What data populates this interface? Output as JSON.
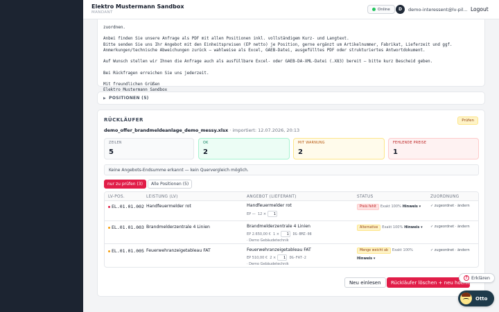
{
  "header": {
    "brand": "Elektro Mustermann Sandbox",
    "brand_sub": "MANDANT",
    "status": "Online",
    "avatar": "D",
    "user": "demo-interessent@lv-pil...",
    "logout": "Logout"
  },
  "mail": {
    "lines": [
      "zuordnen.",
      "",
      "Anbei finden Sie unsere Anfrage als PDF mit allen Positionen inkl. vollständigem Kurz- und Langtext.",
      "Bitte senden Sie uns Ihr Angebot mit den Einheitspreisen (EP netto) je Position, gerne ergänzt um Artikelnummer, Fabrikat, Lieferzeit und ggf.",
      "Anmerkungen/technische Abweichungen zurück — wahlweise als Excel, GAEB-Datei, ausgefülltes PDF oder strukturiertes Antwortdokument.",
      "",
      "Auf Wunsch stellen wir Ihnen die Anfrage auch als ausfüllbare Excel- oder GAEB-DA-XML-Datei (.X83) bereit — bitte kurz Bescheid geben.",
      "",
      "Bei Rückfragen erreichen Sie uns jederzeit.",
      "",
      "Mit freundlichen Grüßen",
      "Elektro Mustermann Sandbox"
    ]
  },
  "positionen": {
    "label": "POSITIONEN (5)"
  },
  "rueck": {
    "title": "RÜCKLÄUFER",
    "badge": "Prüfen",
    "file": "demo_offer_brandmeldeanlage_demo_messy.xlsx",
    "imported": " · importiert: 12.07.2026, 20:13",
    "stats": [
      {
        "label": "ZEILEN",
        "value": "5"
      },
      {
        "label": "OK",
        "value": "2"
      },
      {
        "label": "MIT WARNUNG",
        "value": "2"
      },
      {
        "label": "FEHLENDE PREISE",
        "value": "1"
      }
    ],
    "notice": "Keine Angebots-Endsumme erkannt — kein Quervergleich möglich.",
    "tabs": [
      "nur zu prüfen (3)",
      "Alle Positionen (5)"
    ],
    "columns": [
      "LV-POS.",
      "LEISTUNG (LV)",
      "ANGEBOT (LIEFERANT)",
      "STATUS",
      "ZUORDNUNG"
    ],
    "rows": [
      {
        "pos": "EL.01.01.002",
        "lv": "Handfeuermelder rot",
        "angebot": "Handfeuermelder rot",
        "ep": "EP —",
        "qty_prefix": "12 ×",
        "qty": "1",
        "art": "",
        "fabrikat": "",
        "badge": "Preis fehlt",
        "exakt": "Exakt 100%",
        "hinweis": "Hinweis ▾",
        "zuord": "✓ zugeordnet · ändern"
      },
      {
        "pos": "EL.01.01.003",
        "lv": "Brandmelderzentrale 4 Linien",
        "angebot": "Brandmelderzentrale 4 Linien",
        "ep": "EP 2.650,00 €",
        "qty_prefix": "1 ×",
        "qty": "1",
        "art": "DG-BMZ-08",
        "fabrikat": "· Demo Gebäudetechnik",
        "badge": "Alternative",
        "exakt": "Exakt 100%",
        "hinweis": "Hinweis ▾",
        "zuord": "✓ zugeordnet · ändern"
      },
      {
        "pos": "EL.01.01.005",
        "lv": "Feuerwehranzeigetableau FAT",
        "angebot": "Feuerwehranzeigetableau FAT",
        "ep": "EP 510,00 €",
        "qty_prefix": "2 ×",
        "qty": "1",
        "art": "DG-FAT-2",
        "fabrikat": "· Demo Gebäudetechnik",
        "badge": "Menge weicht ab",
        "exakt": "Exakt 100%",
        "hinweis": "Hinweis ▾",
        "zuord": "✓ zugeordnet · ändern"
      }
    ],
    "btn_neu": "Neu einlesen",
    "btn_del": "Rückläufer löschen + neu hochladen"
  },
  "help": {
    "erklaeren": "Erklären",
    "otto": "Otto",
    "q": "?"
  },
  "colors": {
    "accent": "#e11d48",
    "sidebar": "#1c2431",
    "online": "#22c55e"
  }
}
